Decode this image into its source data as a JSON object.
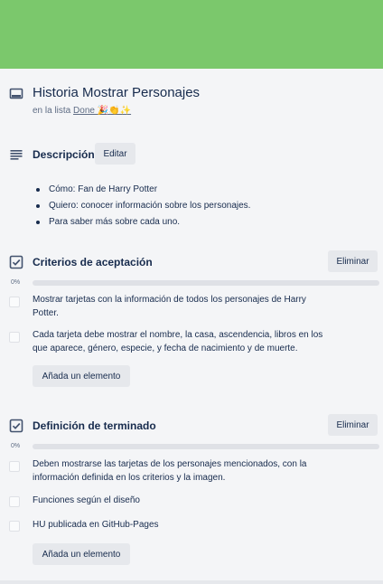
{
  "card": {
    "title": "Historia Mostrar Personajes",
    "in_list_prefix": "en la lista",
    "list_name": "Done 🎉👏✨",
    "cover_color": "#7bc86c"
  },
  "description": {
    "title": "Descripción",
    "edit_label": "Editar",
    "items": [
      "Cómo: Fan de Harry Potter",
      "Quiero: conocer información sobre los personajes.",
      "Para saber más sobre cada uno."
    ]
  },
  "checklists": [
    {
      "title": "Criterios de aceptación",
      "delete_label": "Eliminar",
      "progress_label": "0%",
      "progress": 0,
      "items": [
        "Mostrar tarjetas con la información de todos los personajes de Harry Potter.",
        "Cada tarjeta debe mostrar el nombre, la casa, ascendencia, libros en los que aparece, género, especie, y fecha de nacimiento y de muerte."
      ],
      "add_label": "Añada un elemento"
    },
    {
      "title": "Definición de terminado",
      "delete_label": "Eliminar",
      "progress_label": "0%",
      "progress": 0,
      "items": [
        "Deben mostrarse las tarjetas de los personajes mencionados, con la información definida en los criterios y la imagen.",
        "Funciones según el diseño",
        "HU publicada en GitHub-Pages"
      ],
      "add_label": "Añada un elemento"
    }
  ]
}
